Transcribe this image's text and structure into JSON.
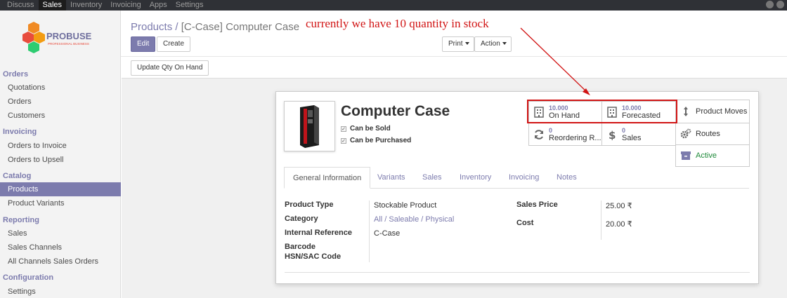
{
  "topbar": {
    "menu": [
      "Discuss",
      "Sales",
      "Inventory",
      "Invoicing",
      "Apps",
      "Settings"
    ],
    "active": "Sales"
  },
  "logo": {
    "text": "PROBUSE",
    "tagline": "PROFESSIONAL BUSINESS"
  },
  "sidebar": {
    "orders_title": "Orders",
    "orders": [
      "Quotations",
      "Orders",
      "Customers"
    ],
    "invoicing_title": "Invoicing",
    "invoicing": [
      "Orders to Invoice",
      "Orders to Upsell"
    ],
    "catalog_title": "Catalog",
    "catalog": [
      "Products",
      "Product Variants"
    ],
    "reporting_title": "Reporting",
    "reporting": [
      "Sales",
      "Sales Channels",
      "All Channels Sales Orders"
    ],
    "configuration_title": "Configuration",
    "configuration": [
      "Settings"
    ]
  },
  "breadcrumb": {
    "parent": "Products",
    "separator": "/",
    "current": "[C-Case] Computer Case"
  },
  "annotation": "currently we have 10 quantity in stock",
  "buttons": {
    "edit": "Edit",
    "create": "Create",
    "print": "Print",
    "action": "Action",
    "update_qty": "Update Qty On Hand"
  },
  "product": {
    "name": "Computer Case",
    "can_be_sold": "Can be Sold",
    "can_be_purchased": "Can be Purchased"
  },
  "smart": {
    "on_hand_value": "10.000",
    "on_hand_label": "On Hand",
    "forecasted_value": "10.000",
    "forecasted_label": "Forecasted",
    "product_moves": "Product Moves",
    "reordering_value": "0",
    "reordering_label": "Reordering R...",
    "sales_value": "0",
    "sales_label": "Sales",
    "routes": "Routes",
    "active": "Active"
  },
  "tabs": [
    "General Information",
    "Variants",
    "Sales",
    "Inventory",
    "Invoicing",
    "Notes"
  ],
  "fields": {
    "product_type_label": "Product Type",
    "product_type": "Stockable Product",
    "category_label": "Category",
    "category": "All / Saleable / Physical",
    "internal_ref_label": "Internal Reference",
    "internal_ref": "C-Case",
    "barcode_label": "Barcode",
    "hsn_label": "HSN/SAC Code",
    "sales_price_label": "Sales Price",
    "sales_price": "25.00 ₹",
    "cost_label": "Cost",
    "cost": "20.00 ₹"
  },
  "colors": {
    "brand": "#7c7bad",
    "highlight": "#d11414",
    "topbar": "#2f3136"
  }
}
